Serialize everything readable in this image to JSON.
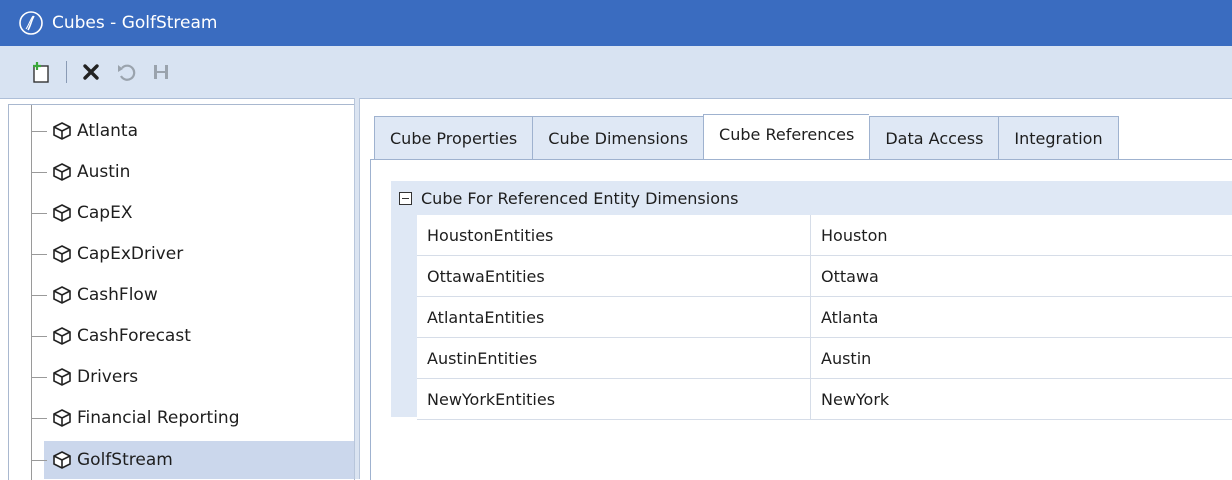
{
  "window": {
    "title": "Cubes - GolfStream",
    "logo_icon": "onestream-logo-icon",
    "title_bg": "#3a6cc0"
  },
  "toolbar": {
    "buttons": [
      {
        "name": "new",
        "icon": "new-document-icon"
      },
      {
        "name": "delete",
        "icon": "delete-x-icon"
      },
      {
        "name": "revert",
        "icon": "undo-icon"
      },
      {
        "name": "save",
        "icon": "save-icon"
      }
    ]
  },
  "tree": {
    "items": [
      {
        "label": "Atlanta",
        "icon": "cube-icon",
        "selected": false
      },
      {
        "label": "Austin",
        "icon": "cube-icon",
        "selected": false
      },
      {
        "label": "CapEX",
        "icon": "cube-icon",
        "selected": false
      },
      {
        "label": "CapExDriver",
        "icon": "cube-icon",
        "selected": false
      },
      {
        "label": "CashFlow",
        "icon": "cube-icon",
        "selected": false
      },
      {
        "label": "CashForecast",
        "icon": "cube-icon",
        "selected": false
      },
      {
        "label": "Drivers",
        "icon": "cube-icon",
        "selected": false
      },
      {
        "label": "Financial Reporting",
        "icon": "cube-icon",
        "selected": false
      },
      {
        "label": "GolfStream",
        "icon": "cube-icon",
        "selected": true
      }
    ]
  },
  "tabs": [
    {
      "label": "Cube Properties",
      "active": false
    },
    {
      "label": "Cube Dimensions",
      "active": false
    },
    {
      "label": "Cube References",
      "active": true
    },
    {
      "label": "Data Access",
      "active": false
    },
    {
      "label": "Integration",
      "active": false
    }
  ],
  "group": {
    "label": "Cube For Referenced Entity Dimensions",
    "expanded": true
  },
  "rows": [
    {
      "key": "HoustonEntities",
      "value": "Houston"
    },
    {
      "key": "OttawaEntities",
      "value": "Ottawa"
    },
    {
      "key": "AtlantaEntities",
      "value": "Atlanta"
    },
    {
      "key": "AustinEntities",
      "value": "Austin"
    },
    {
      "key": "NewYorkEntities",
      "value": "NewYork"
    }
  ]
}
